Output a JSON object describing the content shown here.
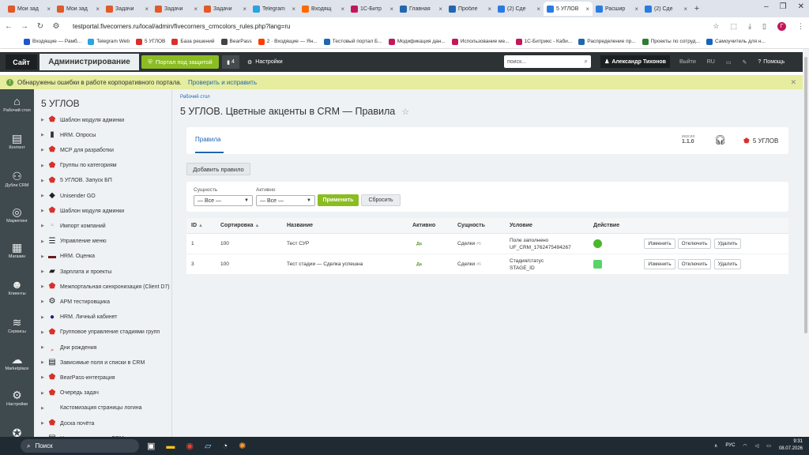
{
  "browser": {
    "tabs": [
      {
        "label": "Мои зад",
        "color": "#e05a2a"
      },
      {
        "label": "Мои зад",
        "color": "#e05a2a"
      },
      {
        "label": "Задачи",
        "color": "#e05a2a"
      },
      {
        "label": "Задачи",
        "color": "#e05a2a"
      },
      {
        "label": "Задачи",
        "color": "#e05a2a"
      },
      {
        "label": "Telegram",
        "color": "#2aa3e0"
      },
      {
        "label": "Входящ",
        "color": "#ff6a00"
      },
      {
        "label": "1С-Битр",
        "color": "#c2185b"
      },
      {
        "label": "Главная",
        "color": "#2067b0"
      },
      {
        "label": "Пробле",
        "color": "#2067b0"
      },
      {
        "label": "(2) Сде",
        "color": "#2a7be0"
      },
      {
        "label": "5 УГЛОВ",
        "color": "#2a7be0"
      },
      {
        "label": "Расшир",
        "color": "#2a7be0"
      },
      {
        "label": "(2) Сде",
        "color": "#2a7be0"
      }
    ],
    "active_tab": 11,
    "new_tab": "+",
    "url": "testportal.fivecorners.ru/local/admin/fivecorners_crmcolors_rules.php?lang=ru",
    "profile_letter": "Г",
    "bookmarks": [
      {
        "label": "Входящие — Рамб...",
        "color": "#2255cc"
      },
      {
        "label": "Telegram Web",
        "color": "#2aa3e0"
      },
      {
        "label": "5 УГЛОВ",
        "color": "#d8312c"
      },
      {
        "label": "База решений",
        "color": "#d8312c"
      },
      {
        "label": "BearPass",
        "color": "#444"
      },
      {
        "label": "2 · Входящие — Ян...",
        "color": "#ff3d00"
      },
      {
        "label": "Тестовый портал Б...",
        "color": "#2067b0"
      },
      {
        "label": "Модификация дан...",
        "color": "#c2185b"
      },
      {
        "label": "Использование ме...",
        "color": "#c2185b"
      },
      {
        "label": "1С-Битрикс - Каби...",
        "color": "#c2185b"
      },
      {
        "label": "Распределение пр...",
        "color": "#2067b0"
      },
      {
        "label": "Проекты по сотруд...",
        "color": "#2e7d32"
      },
      {
        "label": "Самоучитель для н...",
        "color": "#1565c0"
      }
    ]
  },
  "panel": {
    "site": "Сайт",
    "admin": "Администрирование",
    "protect": "Портал под защитой",
    "count": "4",
    "settings": "Настройки",
    "search_placeholder": "поиск...",
    "user": "Александр Тихонов",
    "logout": "Выйти",
    "lang": "RU",
    "help": "Помощь"
  },
  "error": {
    "text": "Обнаружены ошибки в работе корпоративного портала.",
    "link": "Проверить и исправить"
  },
  "iconbar": [
    {
      "label": "Рабочий стол",
      "icon": "home-icon",
      "glyph": "⌂"
    },
    {
      "label": "Контент",
      "icon": "document-icon",
      "glyph": "▤"
    },
    {
      "label": "Дубли CRM",
      "icon": "people-icon",
      "glyph": "⚇"
    },
    {
      "label": "Маркетинг",
      "icon": "target-icon",
      "glyph": "◎"
    },
    {
      "label": "Магазин",
      "icon": "cart-icon",
      "glyph": "▦"
    },
    {
      "label": "Клиенты",
      "icon": "clients-icon",
      "glyph": "☻"
    },
    {
      "label": "Сервисы",
      "icon": "layers-icon",
      "glyph": "≋"
    },
    {
      "label": "Marketplace",
      "icon": "cloud-download-icon",
      "glyph": "☁"
    },
    {
      "label": "Настройки",
      "icon": "gear-icon",
      "glyph": "⚙"
    }
  ],
  "tree": {
    "title": "5 УГЛОВ",
    "items": [
      {
        "label": "Шаблон модуля админки",
        "icon": "red-pentagon-icon",
        "glyph": "⬟",
        "color": "#d8312c"
      },
      {
        "label": "HRM. Опросы",
        "icon": "chart-icon",
        "glyph": "▮",
        "color": "#333"
      },
      {
        "label": "MCP для разработки",
        "icon": "red-pentagon-icon",
        "glyph": "⬟",
        "color": "#d8312c"
      },
      {
        "label": "Группы по категориям",
        "icon": "red-pentagon-icon",
        "glyph": "⬟",
        "color": "#d8312c"
      },
      {
        "label": "5 УГЛОВ. Запуск БП",
        "icon": "red-pentagon-icon",
        "glyph": "⬟",
        "color": "#d8312c"
      },
      {
        "label": "Unisender GO",
        "icon": "unisender-icon",
        "glyph": "◆",
        "color": "#222"
      },
      {
        "label": "Шаблон модуля админки",
        "icon": "red-pentagon-icon",
        "glyph": "⬟",
        "color": "#d8312c"
      },
      {
        "label": "Импорт компаний",
        "icon": "import-icon",
        "glyph": "▫",
        "color": "#999"
      },
      {
        "label": "Управление меню",
        "icon": "menu-icon",
        "glyph": "☰",
        "color": "#222"
      },
      {
        "label": "HRM. Оценка",
        "icon": "hrm-icon",
        "glyph": "▬",
        "color": "#6a1b1b"
      },
      {
        "label": "Зарплата и проекты",
        "icon": "money-icon",
        "glyph": "▰",
        "color": "#222"
      },
      {
        "label": "Межпортальная синхронизация (Client D7)",
        "icon": "red-pentagon-icon",
        "glyph": "⬟",
        "color": "#d8312c"
      },
      {
        "label": "АРМ тестировщика",
        "icon": "gear-icon",
        "glyph": "⚙",
        "color": "#222"
      },
      {
        "label": "HRM. Личный кабинет",
        "icon": "hrm-icon",
        "glyph": "●",
        "color": "#1a237e"
      },
      {
        "label": "Групповое управление стадиями групп",
        "icon": "red-pentagon-icon",
        "glyph": "⬟",
        "color": "#d8312c"
      },
      {
        "label": "Дни рождения",
        "icon": "cake-icon",
        "glyph": "ﹴ",
        "color": "#d8312c"
      },
      {
        "label": "Зависимые поля и списки в CRM",
        "icon": "list-icon",
        "glyph": "▤",
        "color": "#111"
      },
      {
        "label": "BearPass-интеграция",
        "icon": "red-pentagon-icon",
        "glyph": "⬟",
        "color": "#d8312c"
      },
      {
        "label": "Очередь задач",
        "icon": "red-pentagon-icon",
        "glyph": "⬟",
        "color": "#d8312c"
      },
      {
        "label": "Кастомизация страницы логина",
        "icon": "blank-icon",
        "glyph": "",
        "color": "#999"
      },
      {
        "label": "Доска почёта",
        "icon": "red-pentagon-icon",
        "glyph": "⬟",
        "color": "#d8312c"
      },
      {
        "label": "Цветные акценты в CRM",
        "icon": "list-icon",
        "glyph": "▤",
        "color": "#111"
      }
    ]
  },
  "main": {
    "breadcrumb": "Рабочий стол",
    "title": "5 УГЛОВ. Цветные акценты в CRM — Правила",
    "tab_rules": "Правила",
    "version_label": "версия",
    "version": "1.1.0",
    "brand": "5 УГЛОВ",
    "add_rule": "Добавить правило",
    "filter": {
      "entity_label": "Сущность",
      "entity_value": "— Все —",
      "active_label": "Активно",
      "active_value": "— Все —",
      "apply": "Применить",
      "reset": "Сбросить"
    },
    "columns": {
      "id": "ID",
      "sort": "Сортировка",
      "name": "Название",
      "active": "Активно",
      "entity": "Сущность",
      "condition": "Условие",
      "action": "Действие"
    },
    "sort_arrow_id": "▲",
    "sort_arrow_sort": "▲",
    "rows": [
      {
        "id": "1",
        "sort": "100",
        "name": "Тест СУР",
        "active": "Да",
        "entity": "Сделки",
        "entity_code": "#5",
        "condition": "Поле заполнено",
        "condition_code": "UF_CRM_1762475494267",
        "color": "#4bb82a",
        "edit": "Изменить",
        "disable": "Отключить",
        "delete": "Удалить"
      },
      {
        "id": "3",
        "sort": "100",
        "name": "Тест стадии — Сделка успешна",
        "active": "Да",
        "entity": "Сделки",
        "entity_code": "#6",
        "condition": "Стадия/статус",
        "condition_code": "STAGE_ID",
        "color": "#5ad36b",
        "edit": "Изменить",
        "disable": "Отключить",
        "delete": "Удалить"
      }
    ]
  },
  "taskbar": {
    "search": "Поиск",
    "lang": "РУС",
    "time": "9:31",
    "date": "08.07.2026"
  }
}
